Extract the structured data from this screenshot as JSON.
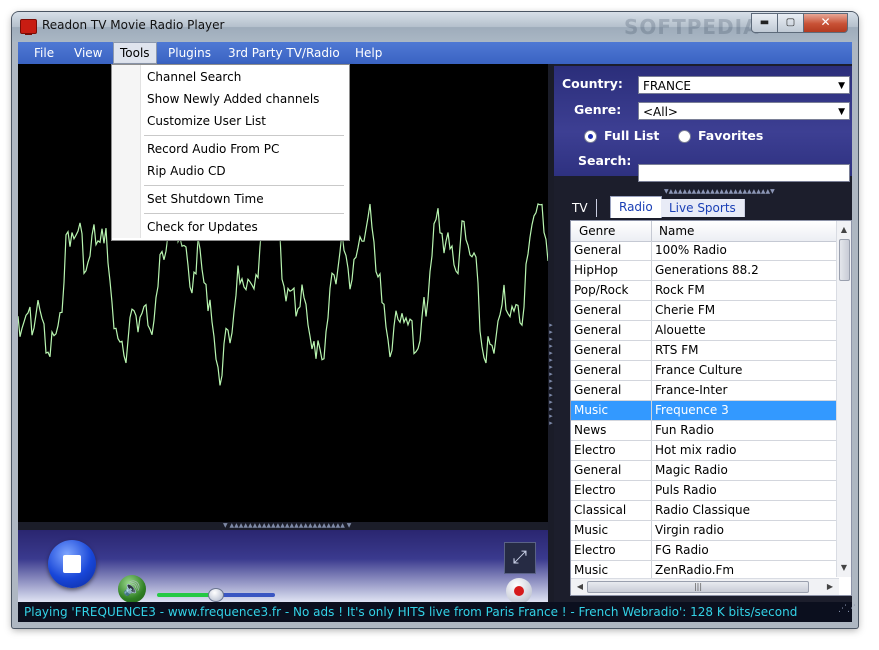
{
  "window": {
    "title": "Readon TV Movie Radio Player",
    "watermark": "SOFTPEDIA",
    "minimize_glyph": "▬",
    "maximize_glyph": "▢",
    "close_glyph": "✕"
  },
  "menubar": {
    "items": [
      "File",
      "View",
      "Tools",
      "Plugins",
      "3rd Party TV/Radio",
      "Help"
    ],
    "active": "Tools"
  },
  "tools_menu": {
    "items": [
      "Channel Search",
      "Show Newly Added channels",
      "Customize User List",
      "Record Audio From PC",
      "Rip Audio CD",
      "Set Shutdown Time",
      "Check for Updates"
    ]
  },
  "filters": {
    "country_label": "Country:",
    "country_value": "FRANCE",
    "genre_label": "Genre:",
    "genre_value": "<All>",
    "full_list_label": "Full List",
    "favorites_label": "Favorites",
    "search_label": "Search:",
    "search_value": "",
    "selected_mode": "Full List"
  },
  "tabs": [
    "TV",
    "Radio",
    "Live Sports"
  ],
  "active_tab": "Radio",
  "channel_list": {
    "columns": [
      "Genre",
      "Name"
    ],
    "rows": [
      {
        "genre": "General",
        "name": "100% Radio"
      },
      {
        "genre": "HipHop",
        "name": "Generations 88.2"
      },
      {
        "genre": "Pop/Rock",
        "name": "Rock FM"
      },
      {
        "genre": "General",
        "name": "Cherie FM"
      },
      {
        "genre": "General",
        "name": "Alouette"
      },
      {
        "genre": "General",
        "name": "RTS FM"
      },
      {
        "genre": "General",
        "name": "France Culture"
      },
      {
        "genre": "General",
        "name": "France-Inter"
      },
      {
        "genre": "Music",
        "name": "Frequence 3"
      },
      {
        "genre": "News",
        "name": "Fun Radio"
      },
      {
        "genre": "Electro",
        "name": "Hot mix radio"
      },
      {
        "genre": "General",
        "name": "Magic Radio"
      },
      {
        "genre": "Electro",
        "name": "Puls Radio"
      },
      {
        "genre": "Classical",
        "name": "Radio Classique"
      },
      {
        "genre": "Music",
        "name": "Virgin radio"
      },
      {
        "genre": "Electro",
        "name": "FG Radio"
      },
      {
        "genre": "Music",
        "name": "ZenRadio.Fm"
      }
    ],
    "selected_row": 8
  },
  "controls": {
    "stop_icon": "stop-icon",
    "volume_icon": "speaker-icon",
    "volume_glyph": "🔊",
    "volume_level": 0.48,
    "fullscreen_glyph": "⤢",
    "record_icon": "record-icon"
  },
  "statusbar": {
    "text": "Playing 'FREQUENCE3 - www.frequence3.fr - No ads ! It's only HITS live from Paris France ! - French Webradio': 128 K bits/second"
  },
  "colors": {
    "menubar": "#3a63c2",
    "waveform": "#b8f5b0",
    "selection": "#3399ff",
    "status_text": "#33d2e6"
  }
}
